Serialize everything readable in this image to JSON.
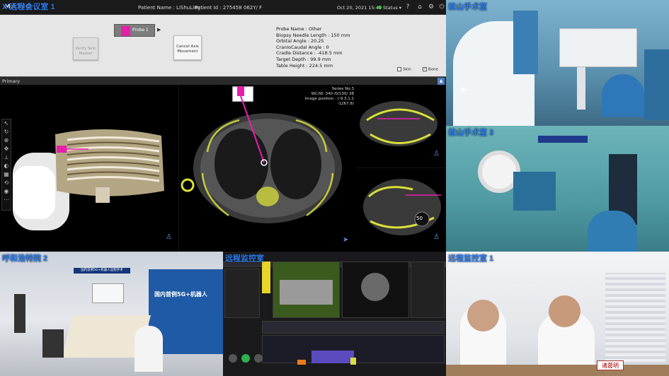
{
  "main": {
    "caption": "X 远程会议室 1",
    "logo": "MAXIO",
    "patient_name": "Patient Name : LiShuLing",
    "patient_id": "Patient Id : 275458 062Y/ F",
    "datetime": "Oct 20, 2021 15:42",
    "status_label": "Status",
    "probe_label": "Probe 1",
    "verify_label": "Verify Skin Marker",
    "cancel_label": "Cancel Axis Movement",
    "info_lines": [
      "Probe Name : Other",
      "Biopsy Needle Length : 150 mm",
      "Orbital Angle : 20.25",
      "CranioCaudal Angle : 0",
      "Cradle Distance : -418.5 mm",
      "Target Depth : 99.9 mm",
      "Table Height : 224.5 mm"
    ],
    "skin_label": "Skin",
    "bone_label": "Bone",
    "primary_label": "Primary",
    "series_lines": [
      "Series No:3",
      "WC/W: 340 /0/130/ 38",
      "Image position : (-9.3.1.1 -1267.8)"
    ],
    "angle_badge": "50"
  },
  "or1": {
    "caption": "松山手术室"
  },
  "or2": {
    "caption": "松山手术室 3"
  },
  "conf1": {
    "caption": "呼和浩特院 2",
    "banner": "国内首例5G+机器人远程手术",
    "wall_text": "国内首例5G+机器人"
  },
  "mon": {
    "caption": "远程监控室"
  },
  "conf2": {
    "caption": "远程监控室 1",
    "nameplate": "诸葛明"
  },
  "colors": {
    "accent": "#e61eab",
    "caption": "#2f7ff0",
    "bone_yellow": "#d9e03a"
  }
}
